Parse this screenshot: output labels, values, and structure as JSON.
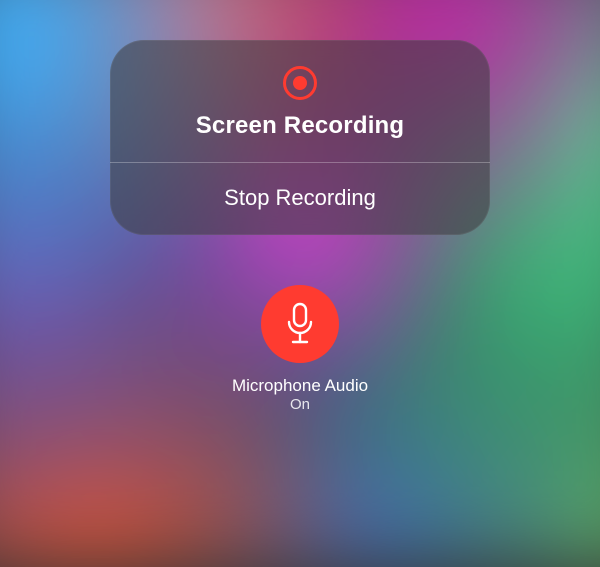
{
  "colors": {
    "accent_red": "#FF3B30"
  },
  "module": {
    "icon": "record-icon",
    "title": "Screen Recording",
    "action_label": "Stop Recording"
  },
  "microphone": {
    "icon": "microphone-icon",
    "label": "Microphone Audio",
    "status": "On",
    "enabled": true
  }
}
